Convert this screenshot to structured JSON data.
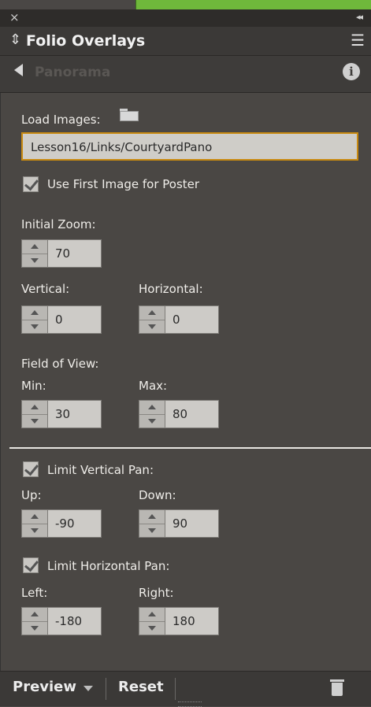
{
  "window": {
    "title": "Folio Overlays",
    "close_icon": "close-icon",
    "collapse_icon": "double-chevron-icon"
  },
  "nav": {
    "breadcrumb": "Panorama"
  },
  "load": {
    "label": "Load Images:",
    "path": "Lesson16/Links/CourtyardPano",
    "poster_checkbox_label": "Use First Image for Poster",
    "poster_checked": true
  },
  "initial_zoom": {
    "label": "Initial Zoom:",
    "value": "70"
  },
  "vertical": {
    "label": "Vertical:",
    "value": "0"
  },
  "horizontal": {
    "label": "Horizontal:",
    "value": "0"
  },
  "field_of_view": {
    "label": "Field of View:",
    "min_label": "Min:",
    "min_value": "30",
    "max_label": "Max:",
    "max_value": "80"
  },
  "limit_vertical": {
    "label": "Limit Vertical Pan:",
    "checked": true,
    "up_label": "Up:",
    "up_value": "-90",
    "down_label": "Down:",
    "down_value": "90"
  },
  "limit_horizontal": {
    "label": "Limit Horizontal Pan:",
    "checked": true,
    "left_label": "Left:",
    "left_value": "-180",
    "right_label": "Right:",
    "right_value": "180"
  },
  "footer": {
    "preview_label": "Preview",
    "reset_label": "Reset"
  },
  "colors": {
    "panel_bg": "#4a4744",
    "focus_border": "#c98a10",
    "top_green": "#6fb83b"
  }
}
